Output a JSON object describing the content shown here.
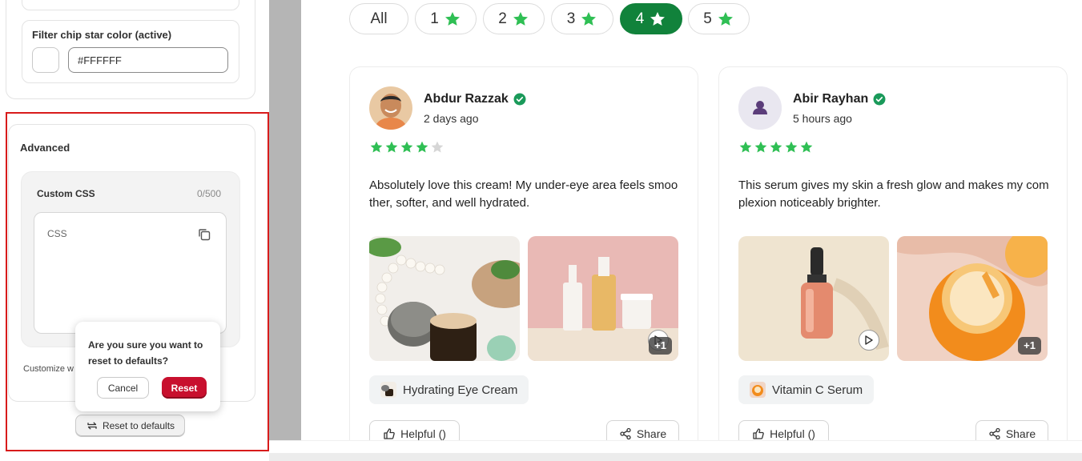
{
  "settings": {
    "filter_chip_star_color": {
      "label": "Filter chip star color (active)",
      "value": "#FFFFFF",
      "swatch_color": "#FFFFFF"
    },
    "advanced": {
      "title": "Advanced",
      "custom_css": {
        "label": "Custom CSS",
        "count": "0/500",
        "placeholder": "CSS"
      },
      "customize_text": "Customize w"
    },
    "reset_button": "Reset to defaults",
    "confirm": {
      "message": "Are you sure you want to reset to defaults?",
      "cancel": "Cancel",
      "reset": "Reset"
    }
  },
  "preview": {
    "filters": [
      {
        "label": "All",
        "star": false,
        "active": false
      },
      {
        "label": "1",
        "star": true,
        "active": false
      },
      {
        "label": "2",
        "star": true,
        "active": false
      },
      {
        "label": "3",
        "star": true,
        "active": false
      },
      {
        "label": "4",
        "star": true,
        "active": true
      },
      {
        "label": "5",
        "star": true,
        "active": false
      }
    ],
    "reviews": [
      {
        "name": "Abdur Razzak",
        "verified": true,
        "time": "2 days ago",
        "rating": 4,
        "text": "Absolutely love this cream! My under-eye area feels smoother, softer, and well hydrated.",
        "media": [
          {
            "kind": "image",
            "subject": "jar-and-pearls"
          },
          {
            "kind": "video",
            "subject": "bottles-on-pink",
            "extra": "+1"
          }
        ],
        "product": "Hydrating Eye Cream",
        "helpful": "Helpful ()",
        "share": "Share"
      },
      {
        "name": "Abir Rayhan",
        "verified": true,
        "time": "5 hours ago",
        "rating": 5,
        "text": "This serum gives my skin a fresh glow and makes my complexion noticeably brighter.",
        "media": [
          {
            "kind": "video",
            "subject": "serum-dropper"
          },
          {
            "kind": "image",
            "subject": "orange-cream-jar",
            "extra": "+1"
          }
        ],
        "product": "Vitamin C Serum",
        "helpful": "Helpful ()",
        "share": "Share"
      }
    ]
  },
  "colors": {
    "star_green": "#2fbf54",
    "active_chip": "#11823b",
    "reset_red": "#c8102e",
    "highlight_border": "#d81b1b",
    "verified_green": "#1a9a5a"
  }
}
